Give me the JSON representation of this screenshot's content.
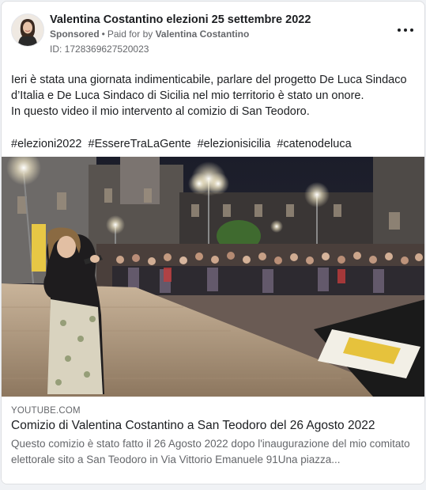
{
  "post": {
    "page_name": "Valentina Costantino elezioni 25 settembre 2022",
    "sponsored_label": "Sponsored",
    "separator": "•",
    "paid_for_prefix": "Paid for by",
    "paid_for_name": "Valentina Costantino",
    "ad_id": "ID: 1728369627520023",
    "more_options_icon": "more-horizontal-icon",
    "body_lines": [
      "Ieri è stata una giornata indimenticabile, parlare del progetto De Luca Sindaco d’Italia e De Luca Sindaco di Sicilia nel mio territorio è stato un onore.",
      "In questo video il mio intervento al comizio di San Teodoro."
    ],
    "hashtags": [
      "#elezioni2022",
      "#EssereTraLaGente",
      "#elezionisicilia",
      "#catenodeluca"
    ]
  },
  "link": {
    "domain": "YOUTUBE.COM",
    "title": "Comizio di Valentina Costantino a San Teodoro del 26 Agosto 2022",
    "description": "Questo comizio è stato fatto il 26 Agosto 2022 dopo l'inaugurazione del mio comitato elettorale sito a San Teodoro in Via Vittorio Emanuele 91Una piazza..."
  },
  "colors": {
    "text_primary": "#1c1e21",
    "text_secondary": "#65676b",
    "card_border": "#dddfe2",
    "background": "#f0f2f5"
  }
}
